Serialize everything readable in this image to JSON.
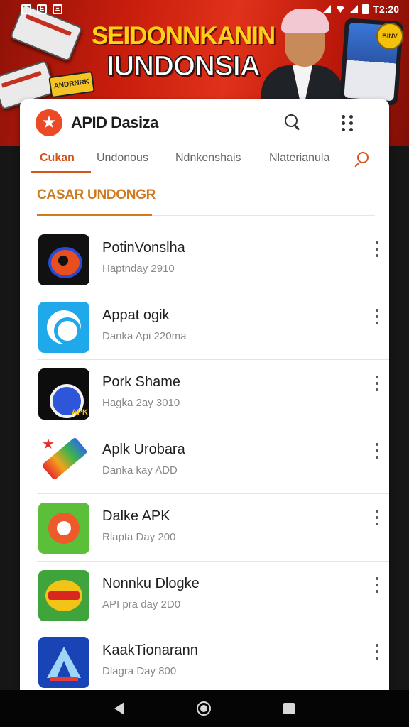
{
  "status_bar": {
    "icons_left": [
      "notification-icon",
      "image-icon",
      "sim-icon"
    ],
    "time": "T2:20"
  },
  "banner": {
    "line1": "SEIDONNKANIN",
    "line2": "IUNDONSIA",
    "tag_text": "ANDRNRK",
    "coin_text": "BINV"
  },
  "app": {
    "title": "APID Dasiza",
    "logo_icon": "star-icon",
    "accent_color": "#d5541c"
  },
  "tabs": [
    {
      "label": "Cukan",
      "active": true
    },
    {
      "label": "Undonous",
      "active": false
    },
    {
      "label": "Ndnkenshais",
      "active": false
    },
    {
      "label": "Nlaterianula",
      "active": false
    }
  ],
  "section": {
    "title": "CASAR UNDONGR"
  },
  "apps": [
    {
      "name": "PotinVonslha",
      "meta": "Haptnday 2910"
    },
    {
      "name": "Appat ogik",
      "meta": "Danka Api 220ma"
    },
    {
      "name": "Pork Shame",
      "meta": "Hagka 2ay 3010"
    },
    {
      "name": "Aplk Urobara",
      "meta": "Danka kay ADD"
    },
    {
      "name": "Dalke APK",
      "meta": "Rlapta Day 200"
    },
    {
      "name": "Nonnku Dlogke",
      "meta": "API pra day 2D0"
    },
    {
      "name": "KaakTionarann",
      "meta": "Dlagra Day 800"
    }
  ]
}
